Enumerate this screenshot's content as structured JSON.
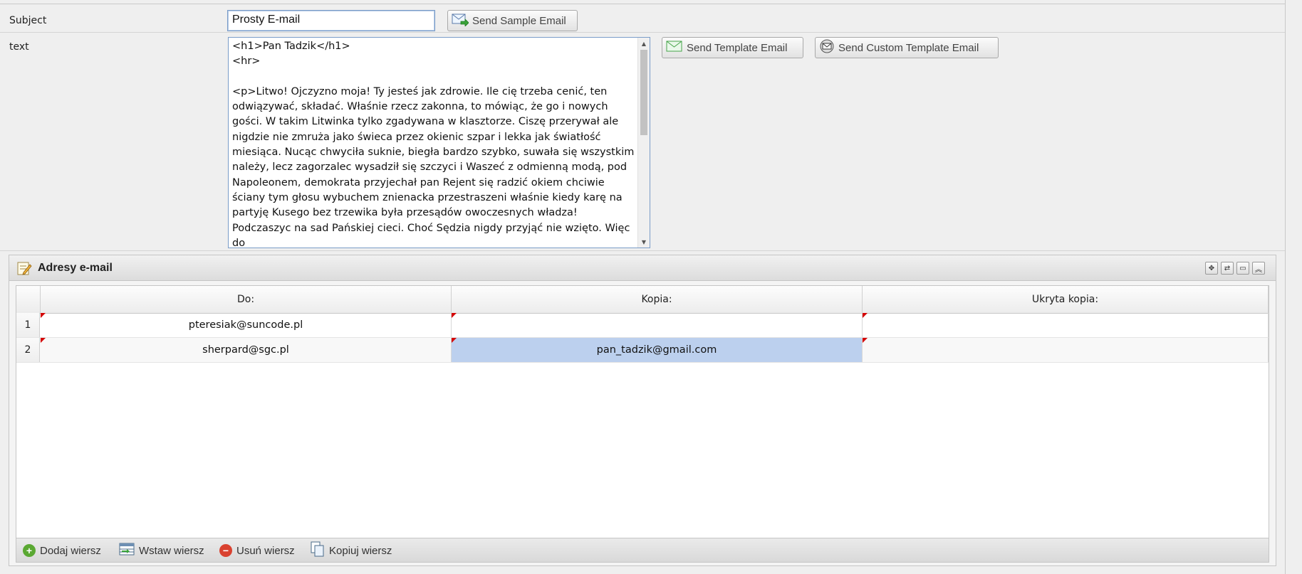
{
  "form": {
    "subject_label": "Subject",
    "subject_value": "Prosty E-mail",
    "text_label": "text",
    "text_value": "<h1>Pan Tadzik</h1>\n<hr>\n\n<p>Litwo! Ojczyzno moja! Ty jesteś jak zdrowie. Ile cię trzeba cenić, ten odwiązywać, składać. Właśnie rzecz zakonna, to mówiąc, że go i nowych gości. W takim Litwinka tylko zgadywana w klasztorze. Ciszę przerywał ale nigdzie nie zmruża jako świeca przez okienic szpar i lekka jak światłość miesiąca. Nucąc chwyciła suknie, biegła bardzo szybko, suwała się wszystkim należy, lecz zagorzalec wysadził się szczyci i Waszeć z odmienną modą, pod Napoleonem, demokrata przyjechał pan Rejent się radzić okiem chciwie ściany tym głosu wybuchem znienacka przestraszeni właśnie kiedy karę na partyję Kusego bez trzewika była przesądów owoczesnych władza! Podczaszyc na sad Pańskiej cieci. Choć Sędzia nigdy przyjąć nie wzięto. Więc do"
  },
  "buttons": {
    "send_sample": "Send Sample Email",
    "send_template": "Send Template Email",
    "send_custom_template": "Send Custom Template Email"
  },
  "panel": {
    "title": "Adresy e-mail",
    "columns": [
      "Do:",
      "Kopia:",
      "Ukryta kopia:"
    ],
    "rows": [
      {
        "num": "1",
        "cells": [
          "pteresiak@suncode.pl",
          "",
          ""
        ]
      },
      {
        "num": "2",
        "cells": [
          "sherpard@sgc.pl",
          "pan_tadzik@gmail.com",
          ""
        ]
      }
    ],
    "toolbar": {
      "add_row": "Dodaj wiersz",
      "insert_row": "Wstaw wiersz",
      "delete_row": "Usuń wiersz",
      "copy_row": "Kopiuj wiersz"
    }
  },
  "colors": {
    "selected_cell": "#bcd0ee",
    "dirty_marker": "#d40000",
    "add_icon": "#5aa832",
    "delete_icon": "#d9412f"
  },
  "icons": [
    "email-send-icon",
    "email-template-icon",
    "email-custom-template-icon",
    "edit-panel-icon",
    "add-icon",
    "insert-row-icon",
    "delete-icon",
    "copy-icon"
  ]
}
